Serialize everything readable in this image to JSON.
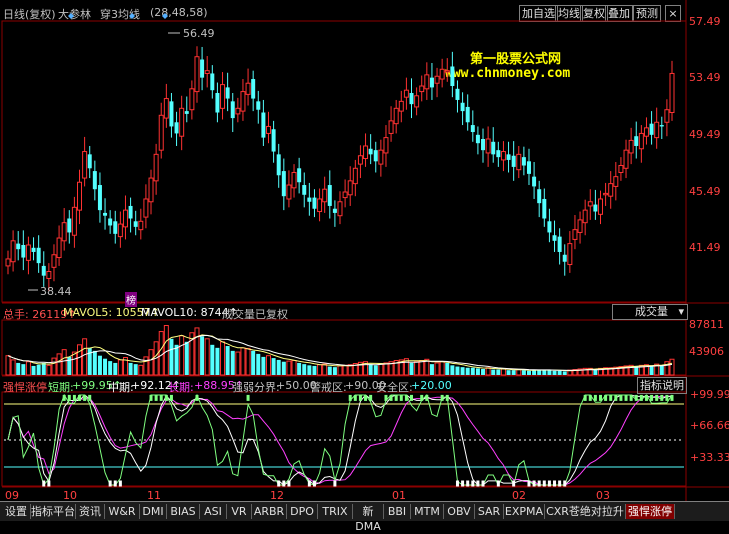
{
  "header": {
    "period": "日线(复权)",
    "stock": "大参林",
    "indicator": "穿3均线",
    "params": "(28,48,58)",
    "buttons": [
      "加自选",
      "均线",
      "复权",
      "叠加",
      "预测"
    ],
    "close_icon": "close-icon"
  },
  "watermark": {
    "line1": "第一股票公式网",
    "line2": "www.chnmoney.com"
  },
  "price_pane": {
    "axis": [
      "57.49",
      "53.49",
      "49.49",
      "45.49",
      "41.49"
    ],
    "max_label": "56.49",
    "min_label": "38.44",
    "axis_max": 57.49,
    "axis_min": 39.49,
    "up_color": "#ff3232",
    "down_color": "#54ffff",
    "marker_label": "榜"
  },
  "volume_pane": {
    "total_label": "总手: 26119↑",
    "mavol5_label": "MAVOL5: 10557↑",
    "mavol10_label": "MAVOL10: 8744↑",
    "note": "成交量已复权",
    "selector": "成交量",
    "axis": [
      "87811",
      "43906"
    ],
    "axis_max": 87811
  },
  "indicator_pane": {
    "name": "强悍涨停",
    "short_label": "短期:",
    "short_value": "+99.95↑",
    "mid_label": "中期:",
    "mid_value": "+92.12↑",
    "long_label": "长期:",
    "long_value": "+88.95↑",
    "zone_label": "强弱分界:",
    "zone_value": "+50.00",
    "warn_label": "警戒区:",
    "warn_value": "+90.00",
    "safe_label": "安全区:",
    "safe_value": "+20.00",
    "help_button": "指标说明",
    "axis": [
      "+99.99",
      "+66.66",
      "+33.33"
    ]
  },
  "time_axis": [
    "09",
    "10",
    "11",
    "12",
    "01",
    "02",
    "03"
  ],
  "tabs": [
    "设置",
    "指标平台",
    "资讯",
    "W&R",
    "DMI",
    "BIAS",
    "ASI",
    "VR",
    "ARBR",
    "DPO",
    "TRIX",
    "新DMA",
    "BBI",
    "MTM",
    "OBV",
    "SAR",
    "EXPMA",
    "CXR苍绝对拉升",
    "强悍涨停"
  ],
  "chart_data": {
    "type": "candlestick",
    "closes": [
      40.5,
      41.8,
      41.2,
      40.6,
      41.5,
      41.0,
      40.2,
      39.3,
      39.6,
      40.8,
      42.0,
      43.1,
      42.4,
      44.2,
      46.0,
      48.2,
      47.0,
      45.5,
      44.0,
      43.6,
      42.9,
      42.3,
      43.0,
      44.0,
      43.4,
      42.8,
      43.2,
      44.8,
      46.3,
      48.0,
      50.8,
      52.0,
      50.0,
      49.5,
      51.3,
      50.9,
      52.7,
      55.0,
      53.5,
      54.0,
      52.6,
      51.0,
      53.0,
      52.0,
      50.6,
      51.3,
      52.5,
      53.1,
      52.0,
      51.2,
      49.2,
      50.0,
      48.2,
      46.5,
      45.0,
      45.8,
      46.7,
      46.0,
      45.1,
      44.6,
      44.1,
      44.8,
      45.5,
      44.3,
      43.8,
      44.6,
      45.3,
      46.1,
      47.0,
      47.9,
      48.6,
      48.0,
      47.5,
      48.3,
      49.2,
      50.4,
      51.3,
      51.8,
      52.6,
      51.6,
      52.2,
      52.9,
      53.7,
      52.8,
      53.6,
      54.1,
      54.0,
      52.9,
      51.9,
      51.1,
      50.3,
      49.6,
      48.8,
      48.3,
      49.1,
      48.0,
      47.8,
      48.2,
      47.6,
      47.1,
      48.0,
      47.2,
      46.6,
      45.7,
      44.5,
      43.4,
      42.4,
      41.8,
      41.0,
      40.3,
      41.6,
      42.6,
      43.3,
      44.0,
      44.6,
      43.9,
      44.8,
      45.2,
      45.9,
      46.4,
      47.2,
      48.3,
      49.0,
      48.6,
      49.5,
      49.9,
      49.4,
      50.3,
      50.0,
      51.2,
      53.8
    ],
    "volumes": [
      32000,
      25000,
      20000,
      18000,
      22000,
      15000,
      17000,
      20000,
      16000,
      28000,
      35000,
      42000,
      30000,
      38000,
      50000,
      60000,
      45000,
      40000,
      32000,
      27000,
      23000,
      20000,
      25000,
      29000,
      20000,
      18000,
      16000,
      30000,
      42000,
      55000,
      72000,
      82000,
      60000,
      50000,
      65000,
      55000,
      70000,
      78000,
      64000,
      60000,
      50000,
      45000,
      55000,
      48000,
      40000,
      38000,
      45000,
      44000,
      40000,
      35000,
      30000,
      32000,
      28000,
      25000,
      22000,
      23000,
      24000,
      20000,
      18000,
      16000,
      15000,
      17000,
      18000,
      14000,
      13000,
      15000,
      16000,
      17000,
      19000,
      21000,
      22000,
      18000,
      16000,
      18000,
      20000,
      22000,
      24000,
      25000,
      27000,
      20000,
      22000,
      24000,
      26000,
      18000,
      20000,
      22000,
      20000,
      16000,
      14000,
      13000,
      12000,
      12000,
      11000,
      10000,
      12000,
      9000,
      9000,
      10000,
      8000,
      8000,
      9000,
      8000,
      7000,
      8000,
      9000,
      9000,
      8000,
      7000,
      7000,
      6000,
      8000,
      9000,
      10000,
      11000,
      11000,
      9000,
      11000,
      12000,
      12000,
      13000,
      14000,
      15000,
      16000,
      14000,
      16000,
      17000,
      15000,
      18000,
      16000,
      22000,
      26119
    ],
    "axis_max_price": 57.49,
    "axis_min_price": 39.49,
    "indicator_range": [
      0,
      100
    ]
  }
}
